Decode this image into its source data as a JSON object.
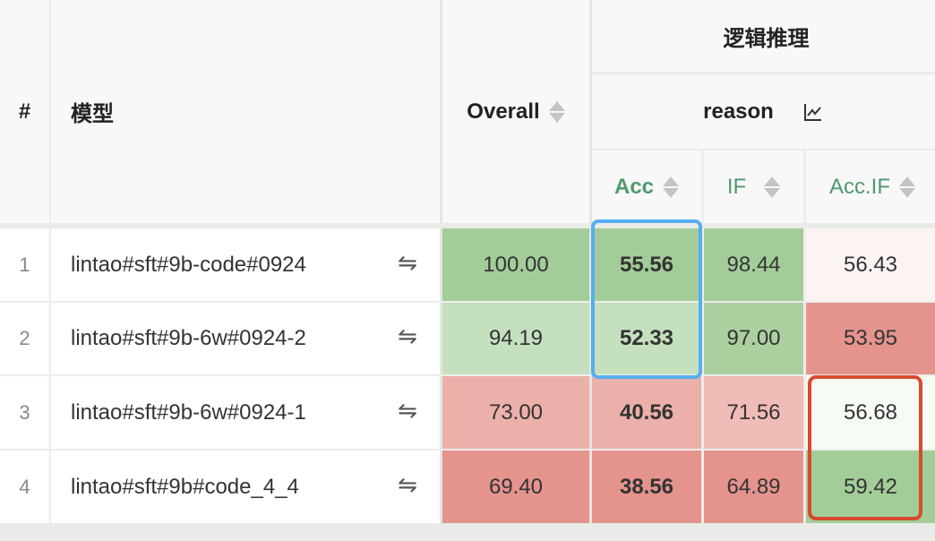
{
  "header": {
    "rank": "#",
    "model": "模型",
    "overall": "Overall",
    "group": "逻辑推理",
    "subgroup": "reason",
    "chart_icon": "line-chart-icon",
    "metrics": [
      "Acc",
      "IF",
      "Acc.IF"
    ]
  },
  "rows": [
    {
      "rank": "1",
      "model": "lintao#sft#9b-code#0924",
      "overall": "100.00",
      "acc": "55.56",
      "if": "98.44",
      "accif": "56.43"
    },
    {
      "rank": "2",
      "model": "lintao#sft#9b-6w#0924-2",
      "overall": "94.19",
      "acc": "52.33",
      "if": "97.00",
      "accif": "53.95"
    },
    {
      "rank": "3",
      "model": "lintao#sft#9b-6w#0924-1",
      "overall": "73.00",
      "acc": "40.56",
      "if": "71.56",
      "accif": "56.68"
    },
    {
      "rank": "4",
      "model": "lintao#sft#9b#code_4_4",
      "overall": "69.40",
      "acc": "38.56",
      "if": "64.89",
      "accif": "59.42"
    }
  ],
  "swap_icon": "⇋",
  "colors": {
    "green_strong": "#a3cd98",
    "green_light": "#c5e0bf",
    "green_mid": "#accf9f",
    "red_strong": "#e5938d",
    "red_mid": "#ecb0aa",
    "red_light": "#f0bcb7",
    "near_white_pink": "#fcf4f3",
    "near_white_green": "#f6fbf4",
    "metric_green": "#4e9a6e",
    "highlight_blue": "#56aef0",
    "highlight_red": "#d84a2f"
  }
}
